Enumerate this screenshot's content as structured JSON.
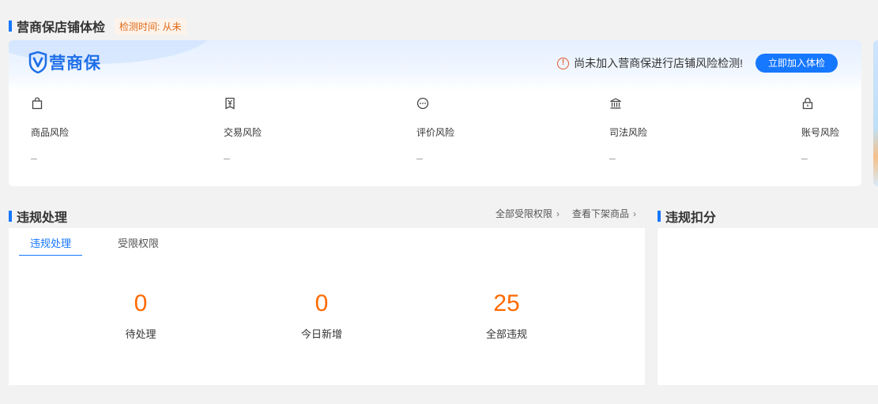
{
  "health_check": {
    "title": "营商保店铺体检",
    "check_time": "检测时间: 从未",
    "logo_text": "营商保",
    "notice_text": "尚未加入营商保进行店铺风险检测!",
    "join_button": "立即加入体检",
    "risks": [
      {
        "icon": "shopping-bag-icon",
        "label": "商品风险",
        "value": "–"
      },
      {
        "icon": "yuan-receipt-icon",
        "label": "交易风险",
        "value": "–"
      },
      {
        "icon": "chat-bubble-icon",
        "label": "评价风险",
        "value": "–"
      },
      {
        "icon": "court-building-icon",
        "label": "司法风险",
        "value": "–"
      },
      {
        "icon": "lock-icon",
        "label": "账号风险",
        "value": "–"
      }
    ]
  },
  "violation": {
    "title": "违规处理",
    "links": [
      {
        "label": "全部受限权限"
      },
      {
        "label": "查看下架商品"
      }
    ],
    "tabs": [
      {
        "label": "违规处理",
        "active": true
      },
      {
        "label": "受限权限",
        "active": false
      }
    ],
    "stats": [
      {
        "value": "0",
        "label": "待处理"
      },
      {
        "value": "0",
        "label": "今日新增"
      },
      {
        "value": "25",
        "label": "全部违规"
      }
    ]
  },
  "deduction": {
    "title": "违规扣分"
  },
  "colors": {
    "accent": "#1677ff",
    "number": "#ff6a00",
    "warning": "#e4572e"
  }
}
